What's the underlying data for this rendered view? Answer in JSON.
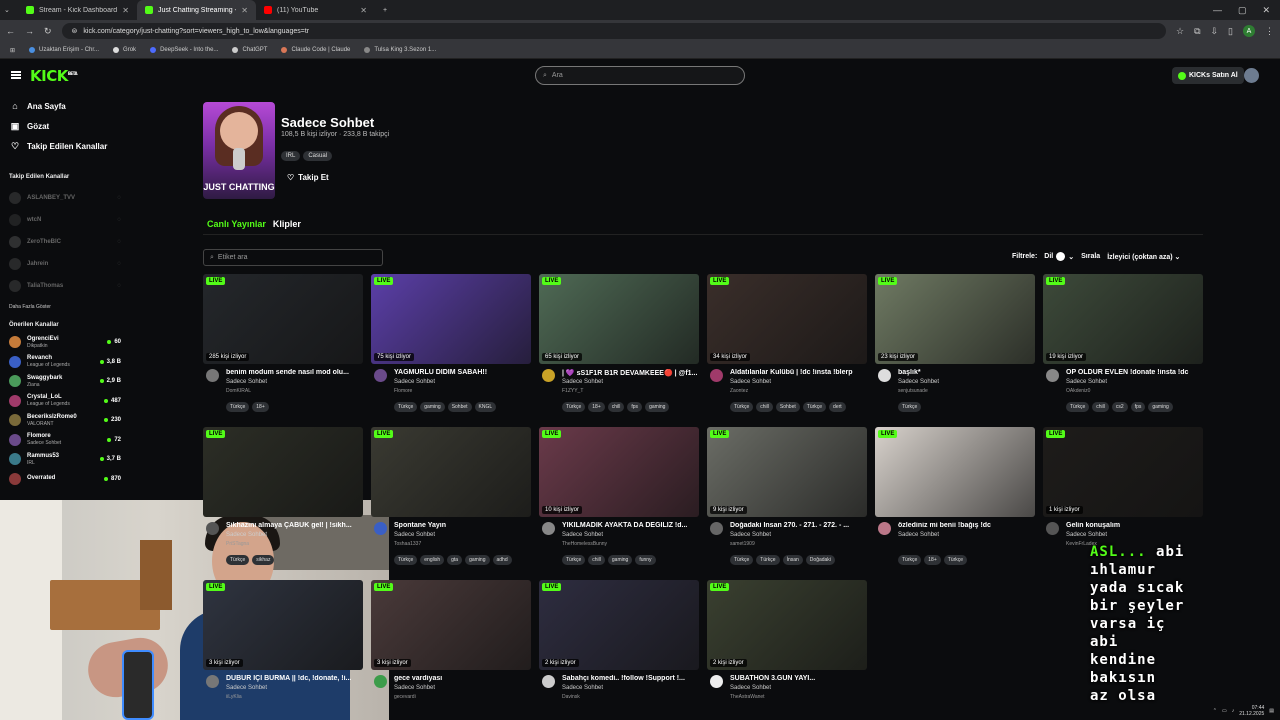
{
  "browser": {
    "tabs": [
      {
        "title": "Stream - Kick Dashboard",
        "color": "#53fc18"
      },
      {
        "title": "Just Chatting Streaming - Livi",
        "color": "#53fc18"
      },
      {
        "title": "(11) YouTube",
        "color": "#ff0000"
      }
    ],
    "url": "kick.com/category/just-chatting?sort=viewers_high_to_low&languages=tr",
    "profile_initial": "A",
    "bookmarks": [
      "Uzaktan Erişim - Chr...",
      "Grok",
      "DeepSeek - Into the...",
      "ChatGPT",
      "Claude Code | Claude",
      "Tulsa King 3.Sezon 1..."
    ]
  },
  "header": {
    "logo": "KICK",
    "logo_sup": "BETA",
    "search_placeholder": "Ara",
    "buy_kicks": "KICKs Satın Al"
  },
  "sidebar": {
    "nav": [
      {
        "icon": "home-icon",
        "glyph": "⌂",
        "label": "Ana Sayfa"
      },
      {
        "icon": "compass-icon",
        "glyph": "▣",
        "label": "Gözat"
      },
      {
        "icon": "heart-icon",
        "glyph": "♡",
        "label": "Takip Edilen Kanallar"
      }
    ],
    "followed_title": "Takip Edilen Kanallar",
    "followed": [
      {
        "name": "ASLANBEY_TVV",
        "color": "#555"
      },
      {
        "name": "wtcN",
        "color": "#444"
      },
      {
        "name": "ZeroTheBIC",
        "color": "#666"
      },
      {
        "name": "Jahrein",
        "color": "#555"
      },
      {
        "name": "TaliaThomas",
        "color": "#555"
      }
    ],
    "show_more": "Daha Fazla Göster",
    "recommended_title": "Önerilen Kanallar",
    "recommended": [
      {
        "name": "OgrenciEvi",
        "sub": "Dikpatkin",
        "count": "60",
        "color": "#c57b3a"
      },
      {
        "name": "Revanch",
        "sub": "League of Legends",
        "count": "3,8 B",
        "color": "#3a5fc5"
      },
      {
        "name": "Swaggybark",
        "sub": "Ziana",
        "count": "2,9 B",
        "color": "#4a9a5a"
      },
      {
        "name": "Crystal_LoL",
        "sub": "League of Legends",
        "count": "487",
        "color": "#a03a6a"
      },
      {
        "name": "BecerikslzRome0",
        "sub": "VALORANT",
        "count": "230",
        "color": "#7a6a3a"
      },
      {
        "name": "Flomore",
        "sub": "Sadece Sohbet",
        "count": "72",
        "color": "#6a4a8a"
      },
      {
        "name": "Rammus53",
        "sub": "IRL",
        "count": "3,7 B",
        "color": "#3a7a8a"
      },
      {
        "name": "Overrated",
        "sub": "",
        "count": "870",
        "color": "#8a3a3a"
      }
    ]
  },
  "category": {
    "title": "Sadece Sohbet",
    "viewers": "108,5 B kişi izliyor",
    "followers": "233,8 B takipçi",
    "tags": [
      "IRL",
      "Casual"
    ],
    "follow": "Takip Et",
    "cover_text": "JUST CHATTING"
  },
  "tabs": [
    "Canlı Yayınlar",
    "Klipler"
  ],
  "tag_search_placeholder": "Etiket ara",
  "filters": {
    "label": "Filtrele:",
    "lang": "Dil",
    "sort_label": "Sırala",
    "sort_value": "İzleyici (çoktan aza)"
  },
  "live_label": "LIVE",
  "streams": [
    {
      "title": "benim modum sende nasıl mod olu...",
      "cat": "Sadece Sohbet",
      "ch": "DomKIRAL",
      "viewers": "285 kişi izliyor",
      "tags": [
        "Türkçe",
        "18+"
      ],
      "bg": "#24272b",
      "av": "#777"
    },
    {
      "title": "YAĞMURLU DİDİM SABAH!!",
      "cat": "Sadece Sohbet",
      "ch": "Flomore",
      "viewers": "75 kişi izliyor",
      "tags": [
        "Türkçe",
        "gaming",
        "Sohbet",
        "KNGL"
      ],
      "bg": "#5b3fa8",
      "av": "#6a4a8a"
    },
    {
      "title": "| 💜 sS1F1R B1R DEVAMKEEE🔴 | @f1...",
      "cat": "Sadece Sohbet",
      "ch": "F1ZYY_T",
      "viewers": "65 kişi izliyor",
      "tags": [
        "Türkçe",
        "18+",
        "chill",
        "fps",
        "gaming"
      ],
      "bg": "#4f6a55",
      "av": "#c9a227"
    },
    {
      "title": "Aldatılanlar Kulübü | !dc !insta !blerp",
      "cat": "Sadece Sohbet",
      "ch": "Zaontez",
      "viewers": "34 kişi izliyor",
      "tags": [
        "Türkçe",
        "chill",
        "Sohbet",
        "Türkçe",
        "dert"
      ],
      "bg": "#3a2e2a",
      "av": "#a03a6a"
    },
    {
      "title": "başlık*",
      "cat": "Sadece Sohbet",
      "ch": "senjutsunade",
      "viewers": "23 kişi izliyor",
      "tags": [
        "Türkçe"
      ],
      "bg": "#6f7a63",
      "av": "#ddd"
    },
    {
      "title": "ÖP ÖLDÜR EVLEN !donate !insta !dc",
      "cat": "Sadece Sohbet",
      "ch": "OAkdeniz0",
      "viewers": "19 kişi izliyor",
      "tags": [
        "Türkçe",
        "chill",
        "cs2",
        "fps",
        "gaming"
      ],
      "bg": "#3d4a3a",
      "av": "#888"
    },
    {
      "title": "Sikhazını almaya ÇABUK gel! | !sikh...",
      "cat": "Sadece Sohbet",
      "ch": "PriSTagna",
      "viewers": "",
      "tags": [
        "Türkçe",
        "sikhaz"
      ],
      "bg": "#2c2e26",
      "av": "#555"
    },
    {
      "title": "Spontane Yayın",
      "cat": "Sadece Sohbet",
      "ch": "Toshaa1337",
      "viewers": "",
      "tags": [
        "Türkçe",
        "english",
        "gta",
        "gaming",
        "adhd"
      ],
      "bg": "#3a3a32",
      "av": "#3a5fc5"
    },
    {
      "title": "YIKILMADIK AYAKTA DA DEĞİLİZ !d...",
      "cat": "Sadece Sohbet",
      "ch": "TheHomelessBunny",
      "viewers": "10 kişi izliyor",
      "tags": [
        "Türkçe",
        "chill",
        "gaming",
        "funny"
      ],
      "bg": "#6a3a4a",
      "av": "#888"
    },
    {
      "title": "Doğadaki İnsan 270. - 271. - 272. - ...",
      "cat": "Sadece Sohbet",
      "ch": "samet1909",
      "viewers": "9 kişi izliyor",
      "tags": [
        "Türkçe",
        "Türkçe",
        "İnsan",
        "Doğadaki"
      ],
      "bg": "#6b6d66",
      "av": "#666"
    },
    {
      "title": "özlediniz mi benii !bağış !dc",
      "cat": "Sadece Sohbet",
      "ch": "",
      "viewers": "",
      "tags": [
        "Türkçe",
        "18+",
        "Türkçe"
      ],
      "bg": "#d8d2cc",
      "av": "#b78"
    },
    {
      "title": "Gelin konuşalım",
      "cat": "Sadece Sohbet",
      "ch": "KevinFrLadex",
      "viewers": "1 kişi izliyor",
      "tags": [],
      "bg": "#1e1c1a",
      "av": "#555"
    },
    {
      "title": "DÜBÜR İÇİ BURMA || !dc, !donate, !i...",
      "cat": "Sadece Sohbet",
      "ch": "iiLyKlia",
      "viewers": "3 kişi izliyor",
      "tags": [],
      "bg": "#2f3440",
      "av": "#777"
    },
    {
      "title": "gece vardiyası",
      "cat": "Sadece Sohbet",
      "ch": "gecevardi",
      "viewers": "3 kişi izliyor",
      "tags": [],
      "bg": "#4a3a3a",
      "av": "#3c9c4a"
    },
    {
      "title": "Sabahçı komedi.. !follow !Support !...",
      "cat": "Sadece Sohbet",
      "ch": "Davinsk",
      "viewers": "2 kişi izliyor",
      "tags": [],
      "bg": "#2e2d40",
      "av": "#ccc"
    },
    {
      "title": "SUBATHON 3.GÜN YAYI...",
      "cat": "Sadece Sohbet",
      "ch": "TheAstraWanet",
      "viewers": "2 kişi izliyor",
      "tags": [],
      "bg": "#3a4030",
      "av": "#eee"
    }
  ],
  "overlay": {
    "user": "ASL...",
    "lines": [
      "abi",
      "ıhlamur",
      "yada sıcak",
      "bir şeyler",
      "varsa iç",
      "abi",
      "kendine",
      "bakısın",
      "az olsa"
    ]
  },
  "taskbar": {
    "time": "07:44",
    "date": "21.12.2025"
  }
}
